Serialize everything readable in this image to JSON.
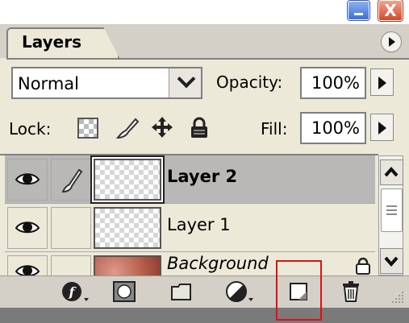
{
  "window": {
    "close_glyph": "X"
  },
  "panel": {
    "tab_label": "Layers",
    "menu_icon": "triangle-right-icon"
  },
  "controls": {
    "blend_mode": "Normal",
    "opacity_label": "Opacity:",
    "opacity_value": "100%",
    "lock_label": "Lock:",
    "fill_label": "Fill:",
    "fill_value": "100%",
    "lock_icons": [
      "lock-transparent-pixels-icon",
      "lock-image-pixels-icon",
      "lock-position-icon",
      "lock-all-icon"
    ]
  },
  "layers": [
    {
      "name": "Layer 2",
      "selected": true,
      "visible": true,
      "italic": false,
      "bold": true
    },
    {
      "name": "Layer 1",
      "selected": false,
      "visible": true,
      "italic": false,
      "bold": false
    },
    {
      "name": "Background",
      "selected": false,
      "visible": true,
      "italic": true,
      "bold": false,
      "locked": true
    }
  ],
  "toolbar": {
    "icons": [
      "add-layer-style-icon",
      "add-layer-mask-icon",
      "new-group-icon",
      "new-adjustment-layer-icon",
      "new-layer-icon",
      "delete-layer-icon"
    ]
  },
  "colors": {
    "panel_bg": "#ece9d8",
    "selected_row": "#b9b8b6",
    "highlight_box": "#e01010"
  }
}
